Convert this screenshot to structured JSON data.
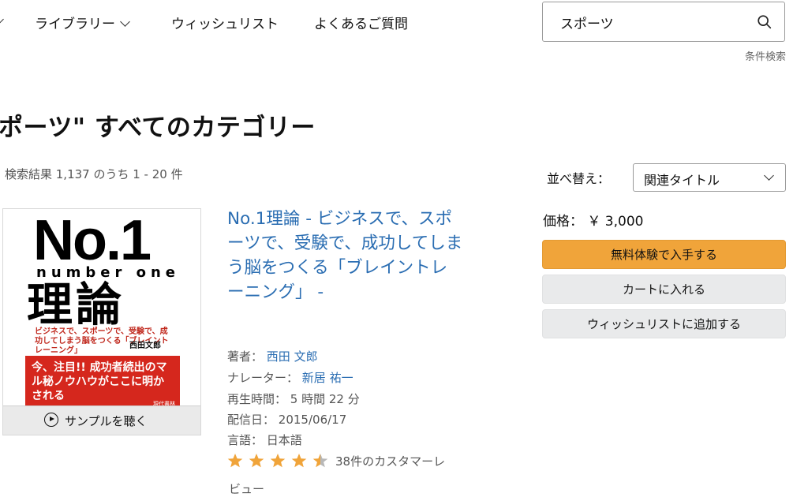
{
  "nav": {
    "items": [
      {
        "label": "ライブラリー",
        "has_dropdown": true
      },
      {
        "label": "ウィッシュリスト",
        "has_dropdown": false
      },
      {
        "label": "よくあるご質問",
        "has_dropdown": false
      }
    ]
  },
  "search": {
    "value": "スポーツ",
    "advanced_link": "条件検索"
  },
  "page_title": "ポーツ\" すべてのカテゴリー",
  "result_count": "検索結果 1,137 のうち 1 - 20 件",
  "sort": {
    "label": "並べ替え：",
    "selected": "関連タイトル"
  },
  "product": {
    "cover": {
      "title_line1": "No.1",
      "title_line2": "number one",
      "title_line3": "理論",
      "subtitle": "ビジネスで、スポーツで、受験で、成功してしまう脳をつくる「ブレイントレーニング」",
      "author": "西田文郎",
      "banner": "今、注目!! 成功者続出のマル秘ノウハウがここに明かされる",
      "publisher": "現代書林"
    },
    "sample_label": "サンプルを聴く",
    "title": "No.1理論 - ビジネスで、スポーツで、受験で、成功してしまう脳をつくる「ブレイントレーニング」 -",
    "author_label": "著者：",
    "author": "西田 文郎",
    "narrator_label": "ナレーター：",
    "narrator": "新居 祐一",
    "length_label": "再生時間：",
    "length": "5 時間 22 分",
    "release_label": "配信日：",
    "release_date": "2015/06/17",
    "language_label": "言語：",
    "language": "日本語",
    "rating": 4.5,
    "reviews_line1": "38件のカスタマーレ",
    "reviews_line2": "ビュー"
  },
  "purchase": {
    "price": "価格： ￥ 3,000",
    "trial_button": "無料体験で入手する",
    "cart_button": "カートに入れる",
    "wishlist_button": "ウィッシュリストに追加する"
  },
  "colors": {
    "link": "#2a6db2",
    "primary_button": "#f0a43a",
    "secondary_button": "#e9eaeb",
    "star": "#f0a43a"
  }
}
